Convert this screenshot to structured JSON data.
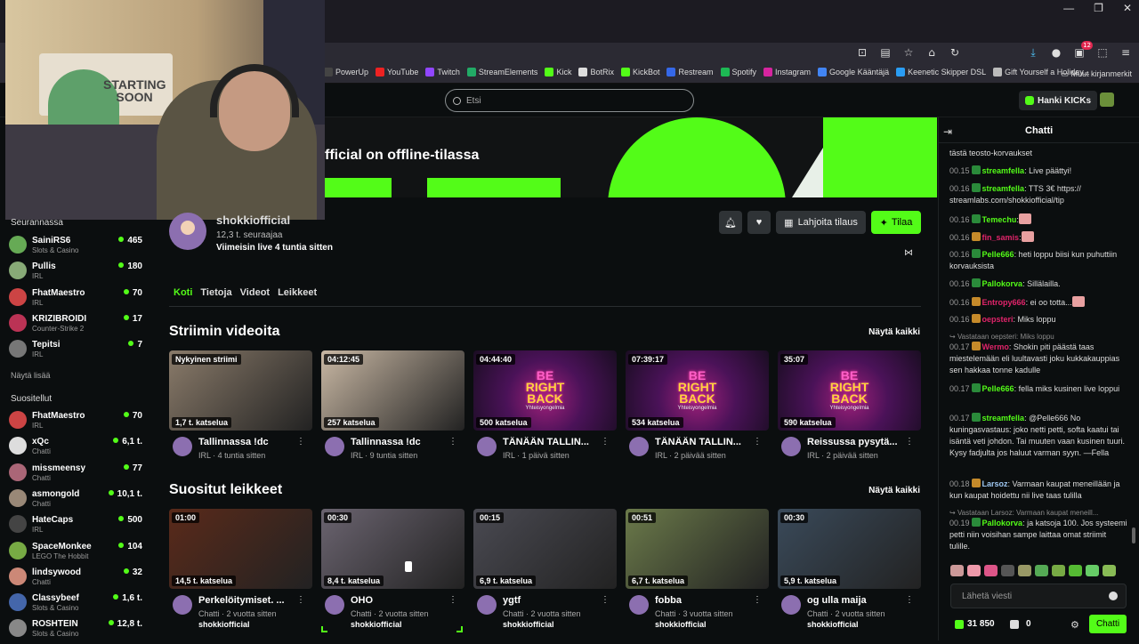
{
  "window_controls": {
    "minimize": "—",
    "restore": "❐",
    "close": "✕"
  },
  "toolbar": {
    "extensions_badge": "12"
  },
  "bookmarks": [
    {
      "label": "PowerUp",
      "color": "#444"
    },
    {
      "label": "YouTube",
      "color": "#e22"
    },
    {
      "label": "Twitch",
      "color": "#9146ff"
    },
    {
      "label": "StreamElements",
      "color": "#2a6"
    },
    {
      "label": "Kick",
      "color": "#53fc18"
    },
    {
      "label": "BotRix",
      "color": "#ddd"
    },
    {
      "label": "KickBot",
      "color": "#53fc18"
    },
    {
      "label": "Restream",
      "color": "#3568e8"
    },
    {
      "label": "Spotify",
      "color": "#1db954"
    },
    {
      "label": "Instagram",
      "color": "#d6249f"
    },
    {
      "label": "Google Kääntäjä",
      "color": "#4285f4"
    },
    {
      "label": "Keenetic Skipper DSL",
      "color": "#2a9df4"
    },
    {
      "label": "Gift Yourself a Holiday...",
      "color": "#bbb"
    }
  ],
  "other_bookmarks": "Muut kirjanmerkit",
  "webcam": {
    "sign_text": "STARTING SOON"
  },
  "header": {
    "search_placeholder": "Etsi",
    "kicks_button": "Hanki KICKs"
  },
  "sidebar": {
    "following_title": "Seurannassa",
    "following": [
      {
        "name": "SainiRS6",
        "category": "Slots & Casino",
        "viewers": "465",
        "color": "#6a5"
      },
      {
        "name": "Pullis",
        "category": "IRL",
        "viewers": "180",
        "color": "#8a7"
      },
      {
        "name": "FhatMaestro",
        "category": "IRL",
        "viewers": "70",
        "color": "#c44"
      },
      {
        "name": "KRIZIBROIDI",
        "category": "Counter-Strike 2",
        "viewers": "17",
        "color": "#b35"
      },
      {
        "name": "Tepitsi",
        "category": "IRL",
        "viewers": "7",
        "color": "#777"
      }
    ],
    "show_more": "Näytä lisää",
    "recommended_title": "Suositellut",
    "recommended": [
      {
        "name": "FhatMaestro",
        "category": "IRL",
        "viewers": "70",
        "color": "#c44"
      },
      {
        "name": "xQc",
        "category": "Chatti",
        "viewers": "6,1 t.",
        "color": "#ddd"
      },
      {
        "name": "missmeensy",
        "category": "Chatti",
        "viewers": "77",
        "color": "#a67"
      },
      {
        "name": "asmongold",
        "category": "Chatti",
        "viewers": "10,1 t.",
        "color": "#987"
      },
      {
        "name": "HateCaps",
        "category": "IRL",
        "viewers": "500",
        "color": "#444"
      },
      {
        "name": "SpaceMonkee",
        "category": "LEGO The Hobbit",
        "viewers": "104",
        "color": "#7a4"
      },
      {
        "name": "lindsywood",
        "category": "Chatti",
        "viewers": "32",
        "color": "#c87"
      },
      {
        "name": "Classybeef",
        "category": "Slots & Casino",
        "viewers": "1,6 t.",
        "color": "#46a"
      },
      {
        "name": "ROSHTEIN",
        "category": "Slots & Casino",
        "viewers": "12,8 t.",
        "color": "#888"
      }
    ]
  },
  "banner": {
    "title": "fficial on offline-tilassa"
  },
  "channel": {
    "name": "shokkiofficial",
    "followers": "12,3 t. seuraajaa",
    "last_live": "Viimeisin live 4 tuntia sitten",
    "gift_button": "Lahjoita tilaus",
    "subscribe_button": "Tilaa"
  },
  "tabs": [
    {
      "label": "Koti",
      "active": true
    },
    {
      "label": "Tietoja",
      "active": false
    },
    {
      "label": "Videot",
      "active": false
    },
    {
      "label": "Leikkeet",
      "active": false
    }
  ],
  "videos_section": {
    "title": "Striimin videoita",
    "show_all": "Näytä kaikki",
    "items": [
      {
        "tag": "Nykyinen striimi",
        "views": "1,7 t. katselua",
        "title": "Tallinnassa !dc",
        "sub": "IRL · 4 tuntia sitten",
        "thumb": "#8a7b6a",
        "brb": false
      },
      {
        "tag": "04:12:45",
        "views": "257 katselua",
        "title": "Tallinnassa !dc",
        "sub": "IRL · 9 tuntia sitten",
        "thumb": "#c9b8a4",
        "brb": false
      },
      {
        "tag": "04:44:40",
        "views": "500 katselua",
        "title": "TÄNÄÄN TALLIN...",
        "sub": "IRL · 1 päivä sitten",
        "thumb": "",
        "brb": true
      },
      {
        "tag": "07:39:17",
        "views": "534 katselua",
        "title": "TÄNÄÄN TALLIN...",
        "sub": "IRL · 2 päivää sitten",
        "thumb": "",
        "brb": true
      },
      {
        "tag": "35:07",
        "views": "590 katselua",
        "title": "Reissussa pysytä...",
        "sub": "IRL · 2 päivää sitten",
        "thumb": "",
        "brb": true
      }
    ],
    "brb_line1": "BE",
    "brb_line2": "RIGHT",
    "brb_line3": "BACK",
    "brb_sub": "Yhteisyongelmia"
  },
  "clips_section": {
    "title": "Suositut leikkeet",
    "show_all": "Näytä kaikki",
    "items": [
      {
        "tag": "01:00",
        "views": "14,5 t. katselua",
        "title": "Perkelöitymiset. ...",
        "sub": "Chatti · 2 vuotta sitten",
        "sub2": "shokkiofficial",
        "thumb": "#5a2a1a"
      },
      {
        "tag": "00:30",
        "views": "8,4 t. katselua",
        "title": "OHO",
        "sub": "Chatti · 2 vuotta sitten",
        "sub2": "shokkiofficial",
        "thumb": "#6b6470"
      },
      {
        "tag": "00:15",
        "views": "6,9 t. katselua",
        "title": "ygtf",
        "sub": "Chatti · 2 vuotta sitten",
        "sub2": "shokkiofficial",
        "thumb": "#4a4a52"
      },
      {
        "tag": "00:51",
        "views": "6,7 t. katselua",
        "title": "fobba",
        "sub": "Chatti · 3 vuotta sitten",
        "sub2": "shokkiofficial",
        "thumb": "#6b7a4a"
      },
      {
        "tag": "00:30",
        "views": "5,9 t. katselua",
        "title": "og ulla maija",
        "sub": "Chatti · 2 vuotta sitten",
        "sub2": "shokkiofficial",
        "thumb": "#3a4a5a"
      }
    ]
  },
  "chat": {
    "title": "Chatti",
    "messages": [
      {
        "time": "",
        "user": "",
        "user_color": "#ddd",
        "text": "tästä teosto-korvaukset"
      },
      {
        "time": "00.15",
        "user": "streamfella",
        "user_color": "#53fc18",
        "text": ": Live päättyi!"
      },
      {
        "time": "00.16",
        "user": "streamfella",
        "user_color": "#53fc18",
        "text": ": TTS 3€ https:// streamlabs.com/shokkiofficial/tip"
      },
      {
        "time": "00.16",
        "user": "Temechu",
        "user_color": "#53fc18",
        "text": ":"
      },
      {
        "time": "00.16",
        "user": "fin_samis",
        "user_color": "#e0246a",
        "text": ":"
      },
      {
        "time": "00.16",
        "user": "Pelle666",
        "user_color": "#53fc18",
        "text": ": heti loppu biisi kun puhuttiin korvauksista"
      },
      {
        "time": "00.16",
        "user": "Pallokorva",
        "user_color": "#53fc18",
        "text": ": Sillälailla."
      },
      {
        "time": "00.16",
        "user": "Entropy666",
        "user_color": "#e0246a",
        "text": ": ei oo totta..."
      },
      {
        "time": "00.16",
        "user": "oepsteri",
        "user_color": "#e0246a",
        "text": ": Miks loppu"
      },
      {
        "time": "00.17",
        "user": "Wermo",
        "user_color": "#e0246a",
        "text": ": Shokin piti päästä taas miestelemään eli luultavasti joku kukkakauppias sen hakkaa tonne kadulle"
      },
      {
        "time": "00.17",
        "user": "Pelle666",
        "user_color": "#53fc18",
        "text": ": fella miks kusinen live loppui"
      },
      {
        "time": "00.17",
        "user": "streamfella",
        "user_color": "#53fc18",
        "text": ": @Pelle666 No kuningasvastaus: joko netti petti, softa kaatui tai isäntä veti johdon. Tai muuten vaan kusinen tuuri. Kysy fadjulta jos haluut varman syyn. —Fella"
      },
      {
        "time": "00.18",
        "user": "Larsoz",
        "user_color": "#9ec6f0",
        "text": ": Varmaan kaupat meneillään ja kun kaupat hoidettu nii live taas tulilla"
      },
      {
        "time": "00.19",
        "user": "Pallokorva",
        "user_color": "#53fc18",
        "text": ": ja katsoja 100. Jos systeemi petti niin voisihan sampe laittaa omat striimit tulille."
      }
    ],
    "reply1": "Vastataan oepsteri: Miks loppu",
    "reply2": "Vastataan Larsoz: Varmaan kaupat meneill...",
    "input_placeholder": "Lähetä viesti",
    "points": "31 850",
    "gifts": "0",
    "send_button": "Chatti"
  }
}
